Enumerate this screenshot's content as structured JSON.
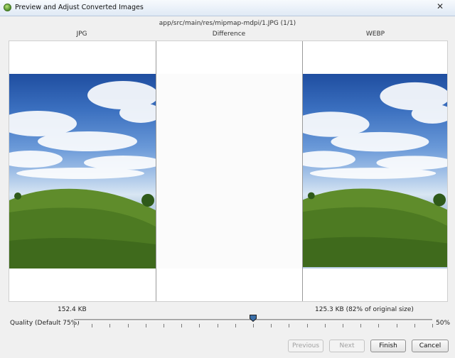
{
  "window": {
    "title": "Preview and Adjust Converted Images",
    "close_glyph": "✕"
  },
  "file_path": "app/src/main/res/mipmap-mdpi/1.JPG (1/1)",
  "columns": {
    "jpg": "JPG",
    "difference": "Difference",
    "webp": "WEBP"
  },
  "sizes": {
    "jpg": "152.4 KB",
    "webp": "125.3 KB (82% of original size)"
  },
  "quality": {
    "label": "Quality (Default 75%)",
    "value_text": "50%",
    "level": 0.5
  },
  "buttons": {
    "previous": "Previous",
    "next": "Next",
    "finish": "Finish",
    "cancel": "Cancel"
  },
  "colors": {
    "sky": "#2f5fae",
    "grass": "#5e8a2a",
    "slider_thumb": "#1f1f1f"
  },
  "icons": {
    "app": "android-studio-icon",
    "close": "close-icon"
  }
}
